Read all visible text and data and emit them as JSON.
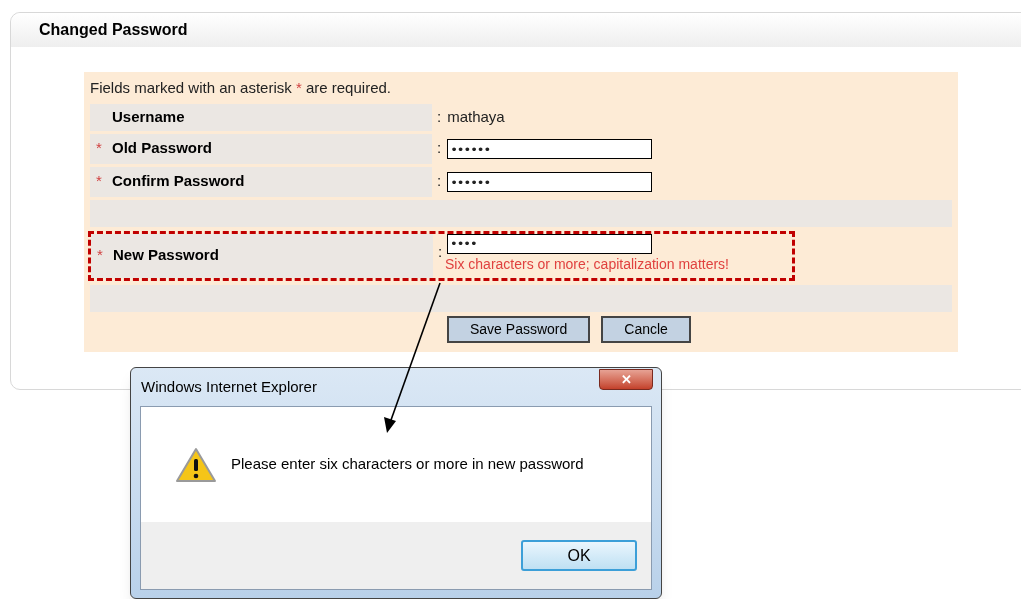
{
  "panel": {
    "title": "Changed Password"
  },
  "form": {
    "note": {
      "before": "Fields marked with an asterisk",
      "mark": "*",
      "after": "are required."
    },
    "rows": [
      {
        "kind": "static",
        "label": "Username",
        "separator": ":",
        "value": "mathaya"
      },
      {
        "kind": "password",
        "required_mark": "*",
        "label": "Old Password",
        "separator": ":",
        "value": "••••••"
      },
      {
        "kind": "password",
        "required_mark": "*",
        "label": "Confirm Password",
        "separator": ":",
        "value": "••••••"
      },
      {
        "kind": "spacer"
      },
      {
        "kind": "password",
        "required_mark": "*",
        "label": "New Password",
        "separator": ":",
        "value": "••••",
        "hint": "Six characters or more; capitalization matters!",
        "highlighted": true
      },
      {
        "kind": "spacer"
      }
    ],
    "buttons": [
      "Save Password",
      "Cancle"
    ]
  },
  "dialog": {
    "title": "Windows Internet Explorer",
    "close": "✕",
    "message": "Please enter six characters or more in new password",
    "buttons": [
      "OK"
    ]
  }
}
